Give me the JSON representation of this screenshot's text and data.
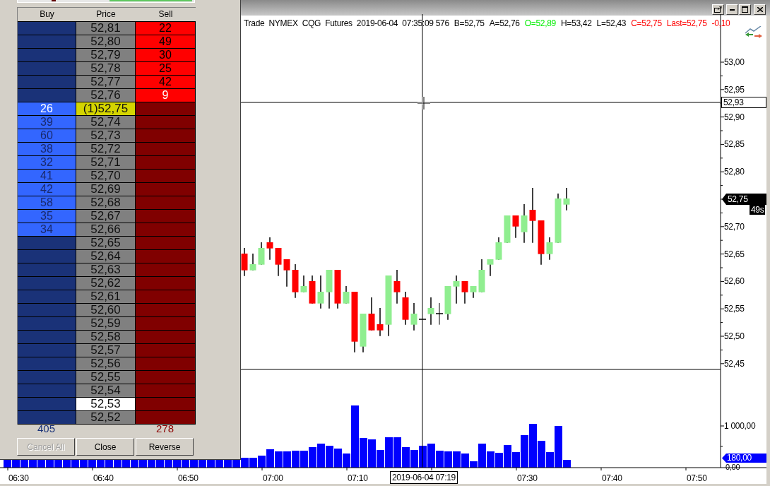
{
  "chart_window": {
    "header": [
      {
        "text": "Trade  NYMEX  CQG  Futures  2019-06-04  07:35:09",
        "color": "#000000"
      },
      {
        "text": "576",
        "color": "#000000"
      },
      {
        "text": "B=52,75",
        "color": "#000000"
      },
      {
        "text": "A=52,76",
        "color": "#000000"
      },
      {
        "text": "O=52,89",
        "color": "#00ee00"
      },
      {
        "text": "H=53,42",
        "color": "#000000"
      },
      {
        "text": "L=52,43",
        "color": "#000000"
      },
      {
        "text": "C=52,75",
        "color": "#ff0000"
      },
      {
        "text": "Last=52,75",
        "color": "#ff0000"
      },
      {
        "text": "-0,10",
        "color": "#ff0000"
      }
    ],
    "price_axis": {
      "labels": [
        "53,00",
        "52,95",
        "52,90",
        "52,85",
        "52,80",
        "52,70",
        "52,65",
        "52,60",
        "52,55",
        "52,50",
        "52,45"
      ],
      "crosshair_price": "52,93",
      "last_price": "52,75",
      "countdown": "49s"
    },
    "volume_axis": {
      "labels": [
        "1 000,00",
        "0,00"
      ],
      "last_volume": "180,00"
    },
    "time_axis": {
      "labels": [
        "06:30",
        "06:40",
        "06:50",
        "07:00",
        "07:10",
        "07:30",
        "07:40",
        "07:50"
      ],
      "crosshair_time": "2019-06-04 07:19"
    }
  },
  "dom": {
    "columns": [
      "Buy",
      "Price",
      "Sell"
    ],
    "rows": [
      {
        "price": "52,81",
        "sell": {
          "qty": "22",
          "best": false
        },
        "kind": "price"
      },
      {
        "price": "52,80",
        "sell": {
          "qty": "49",
          "best": false
        },
        "kind": "price"
      },
      {
        "price": "52,79",
        "sell": {
          "qty": "30",
          "best": false
        },
        "kind": "price"
      },
      {
        "price": "52,78",
        "sell": {
          "qty": "25",
          "best": false
        },
        "kind": "price"
      },
      {
        "price": "52,77",
        "sell": {
          "qty": "42",
          "best": false
        },
        "kind": "price"
      },
      {
        "price": "52,76",
        "sell": {
          "qty": "9",
          "best": true
        },
        "kind": "price"
      },
      {
        "buy": {
          "qty": "26",
          "best": true
        },
        "price": "(1)52,75",
        "kind": "current"
      },
      {
        "buy": {
          "qty": "39",
          "best": false
        },
        "price": "52,74",
        "kind": "price"
      },
      {
        "buy": {
          "qty": "60",
          "best": false
        },
        "price": "52,73",
        "kind": "price"
      },
      {
        "buy": {
          "qty": "38",
          "best": false
        },
        "price": "52,72",
        "kind": "price"
      },
      {
        "buy": {
          "qty": "32",
          "best": false
        },
        "price": "52,71",
        "kind": "price"
      },
      {
        "buy": {
          "qty": "41",
          "best": false
        },
        "price": "52,70",
        "kind": "price"
      },
      {
        "buy": {
          "qty": "42",
          "best": false
        },
        "price": "52,69",
        "kind": "price"
      },
      {
        "buy": {
          "qty": "58",
          "best": false
        },
        "price": "52,68",
        "kind": "price"
      },
      {
        "buy": {
          "qty": "35",
          "best": false
        },
        "price": "52,67",
        "kind": "price"
      },
      {
        "buy": {
          "qty": "34",
          "best": false
        },
        "price": "52,66",
        "kind": "price"
      },
      {
        "price": "52,65",
        "kind": "price"
      },
      {
        "price": "52,64",
        "kind": "price"
      },
      {
        "price": "52,63",
        "kind": "price"
      },
      {
        "price": "52,62",
        "kind": "price"
      },
      {
        "price": "52,61",
        "kind": "price"
      },
      {
        "price": "52,60",
        "kind": "price"
      },
      {
        "price": "52,59",
        "kind": "price"
      },
      {
        "price": "52,58",
        "kind": "price"
      },
      {
        "price": "52,57",
        "kind": "price"
      },
      {
        "price": "52,56",
        "kind": "price"
      },
      {
        "price": "52,55",
        "kind": "price"
      },
      {
        "price": "52,54",
        "kind": "price"
      },
      {
        "price": "52,53",
        "kind": "marked"
      },
      {
        "price": "52,52",
        "kind": "price"
      }
    ],
    "totals": {
      "buy": "405",
      "sell": "278"
    },
    "buttons": [
      {
        "label": "Cancel All",
        "disabled": true
      },
      {
        "label": "Close",
        "disabled": false
      },
      {
        "label": "Reverse",
        "disabled": false
      }
    ]
  }
}
